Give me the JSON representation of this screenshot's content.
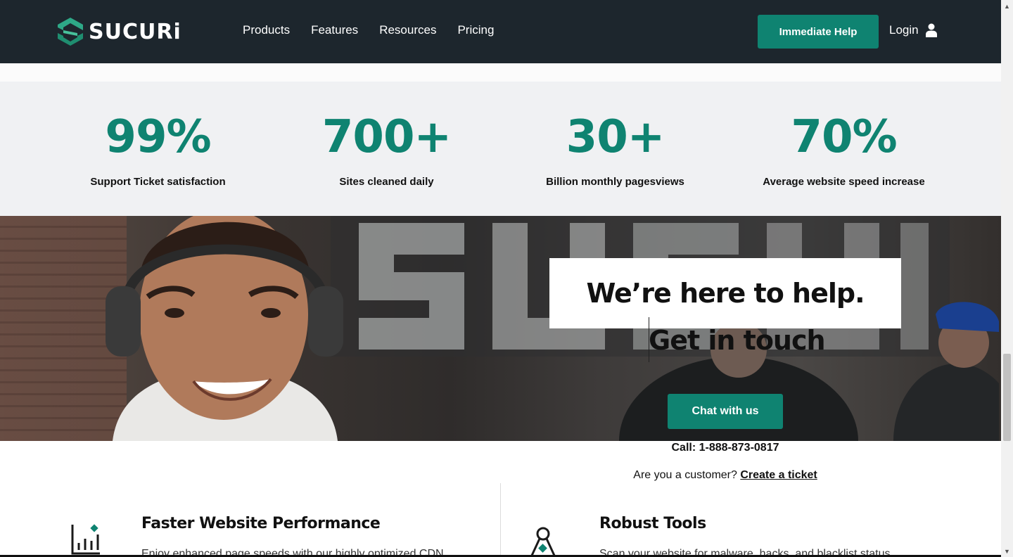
{
  "header": {
    "logo_text": "SUCURi",
    "nav": [
      "Products",
      "Features",
      "Resources",
      "Pricing"
    ],
    "help_button": "Immediate Help",
    "login_label": "Login",
    "login_icon": "user-icon"
  },
  "stats": [
    {
      "value": "99%",
      "label": "Support Ticket satisfaction"
    },
    {
      "value": "700+",
      "label": "Sites cleaned daily"
    },
    {
      "value": "30+",
      "label": "Billion monthly pagesviews"
    },
    {
      "value": "70%",
      "label": "Average website speed increase"
    }
  ],
  "hero": {
    "title": "We’re here to help.",
    "subtitle": "Get in touch",
    "chat_button": "Chat with us"
  },
  "contact": {
    "call": "Call: 1-888-873-0817",
    "customer_prefix": "Are you a customer?",
    "ticket_link": "Create a ticket"
  },
  "features": [
    {
      "icon": "bar-chart-icon",
      "title": "Faster Website Performance",
      "text": "Enjoy enhanced page speeds with our highly optimized CDN"
    },
    {
      "icon": "compass-icon",
      "title": "Robust Tools",
      "text": "Scan your website for malware, hacks, and blacklist status"
    }
  ],
  "colors": {
    "brand": "#0f8371",
    "header_bg": "#1d262d",
    "stats_bg": "#f0f1f3"
  }
}
